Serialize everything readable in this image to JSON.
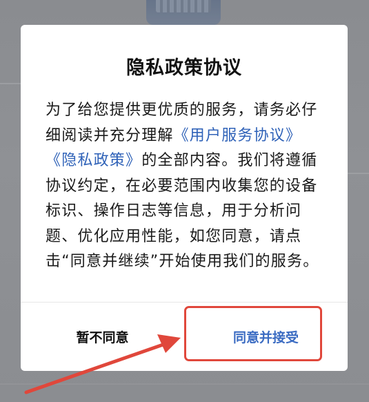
{
  "dialog": {
    "title": "隐私政策协议",
    "body_prefix": "为了给您提供更优质的服务，请务必仔细阅读并充分理解",
    "link_user_agreement": "《用户服务协议》",
    "link_privacy_policy": "《隐私政策》",
    "body_suffix": "的全部内容。我们将遵循协议约定，在必要范围内收集您的设备标识、操作日志等信息，用于分析问题、优化应用性能，如您同意，请点击“同意并继续”开始使用我们的服务。",
    "decline_label": "暂不同意",
    "accept_label": "同意并接受"
  },
  "colors": {
    "link": "#2f62b8",
    "accept": "#3a6bc2",
    "highlight": "#e0473b",
    "overlay": "#8c8e92"
  },
  "annotations": {
    "highlight_target": "accept-button",
    "arrow_icon": "red-arrow-icon"
  }
}
